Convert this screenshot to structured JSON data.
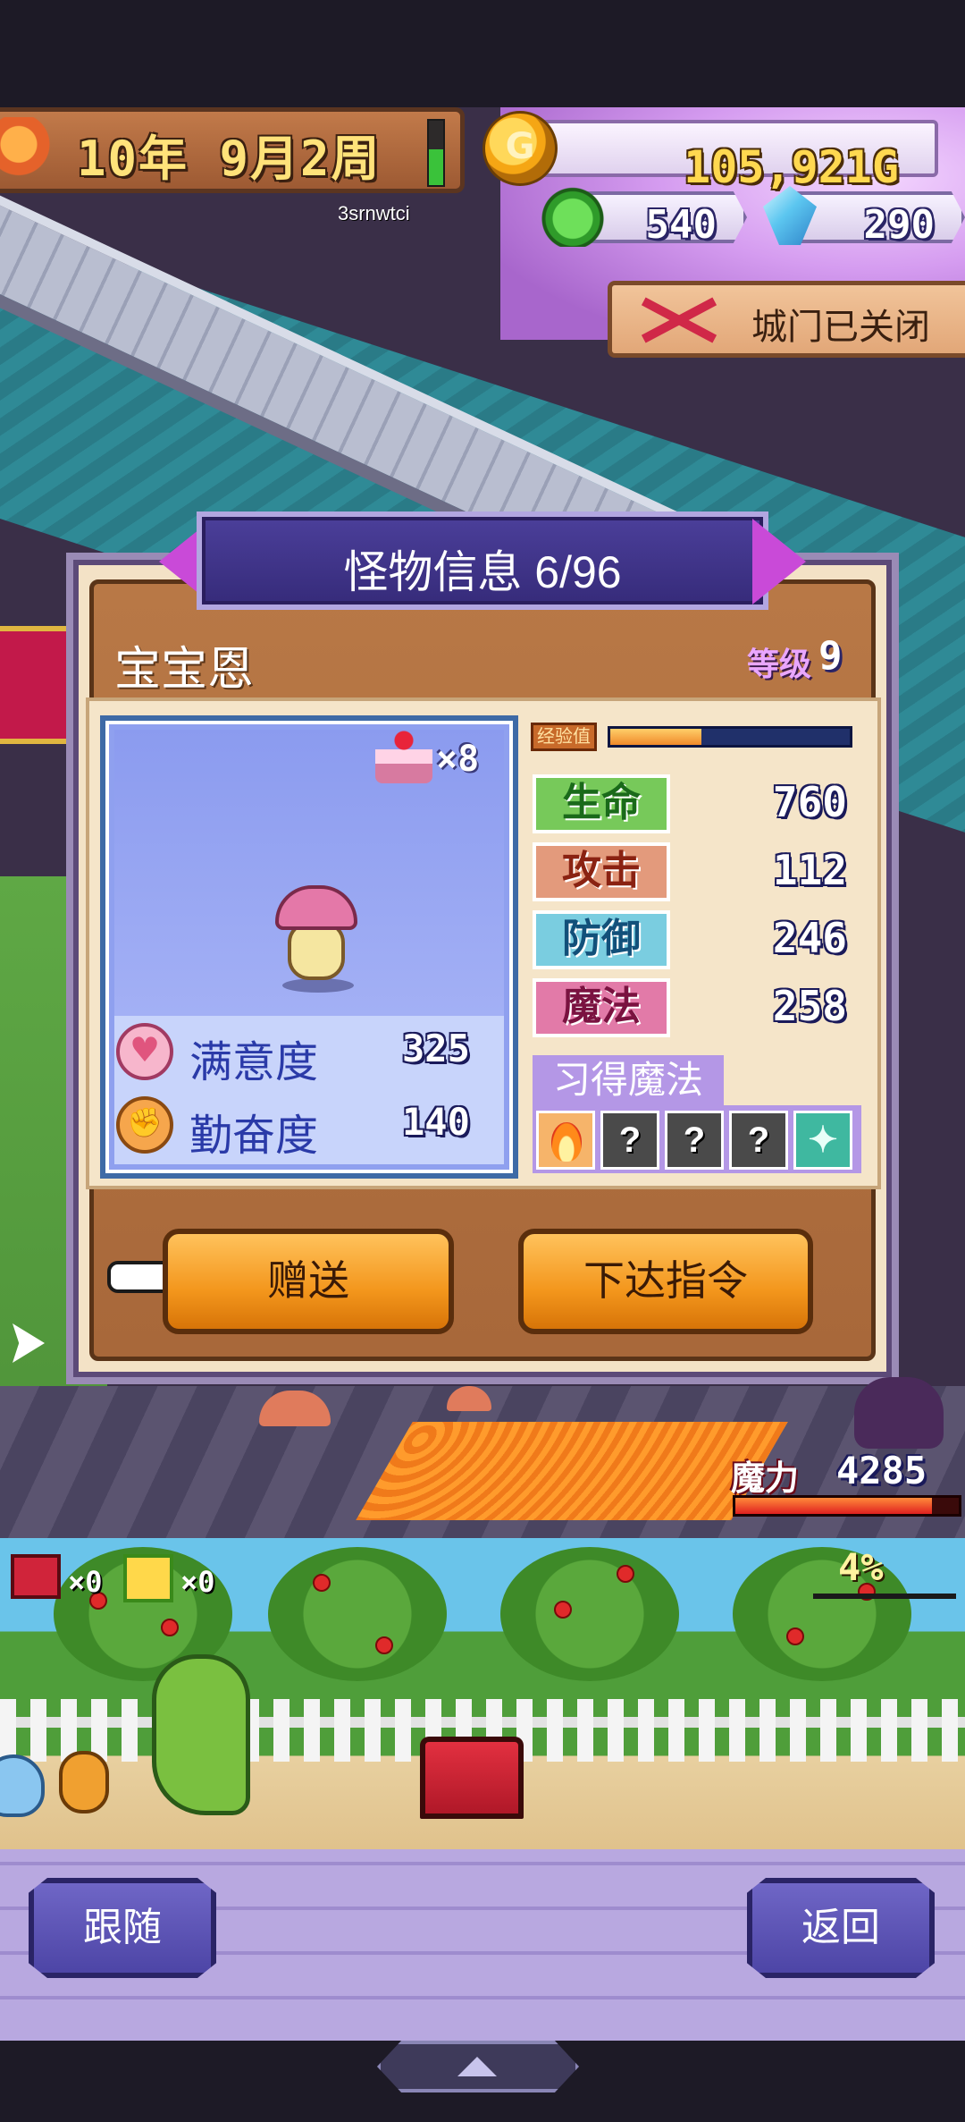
{
  "hud": {
    "date": "10年 9月2周",
    "gold": "105,921G",
    "monster_pts": "540",
    "crystals": "290",
    "time_gauge": 0.55,
    "player_id": "3srnwtci",
    "gate_status": "城门已关闭",
    "icons": {
      "season": "autumn-leaf-icon",
      "gold": "gold-coin-icon",
      "monster_pts": "green-monster-icon",
      "crystal": "blue-crystal-icon",
      "gate": "red-x-icon"
    }
  },
  "panel": {
    "title": "怪物信息 6/96",
    "monster_name": "宝宝恩",
    "level_label": "等级",
    "level_value": "9",
    "food_count": "×8",
    "satisfaction_label": "满意度",
    "satisfaction_value": "325",
    "diligence_label": "勤奋度",
    "diligence_value": "140",
    "exp_label": "经验值",
    "exp_fraction": 0.38,
    "stats": {
      "hp_label": "生命",
      "hp_value": "760",
      "atk_label": "攻击",
      "atk_value": "112",
      "def_label": "防御",
      "def_value": "246",
      "mag_label": "魔法",
      "mag_value": "258"
    },
    "skills_header": "习得魔法",
    "skills": [
      "fire-magic-icon",
      "?",
      "?",
      "?",
      "sparkle-magic-icon"
    ],
    "buttons": {
      "gift": "赠送",
      "command": "下达指令"
    }
  },
  "mana": {
    "label": "魔力",
    "value": "4285",
    "fraction": 0.88
  },
  "orchard": {
    "chest_count": "×0",
    "gift_count": "×0",
    "percent": "4%"
  },
  "bottom": {
    "follow_label": "跟随",
    "back_label": "返回"
  },
  "colors": {
    "panel_brown": "#a8683a",
    "button_orange": "#f3961c",
    "nav_purple": "#4d45a6",
    "title_blue": "#362b7a"
  }
}
